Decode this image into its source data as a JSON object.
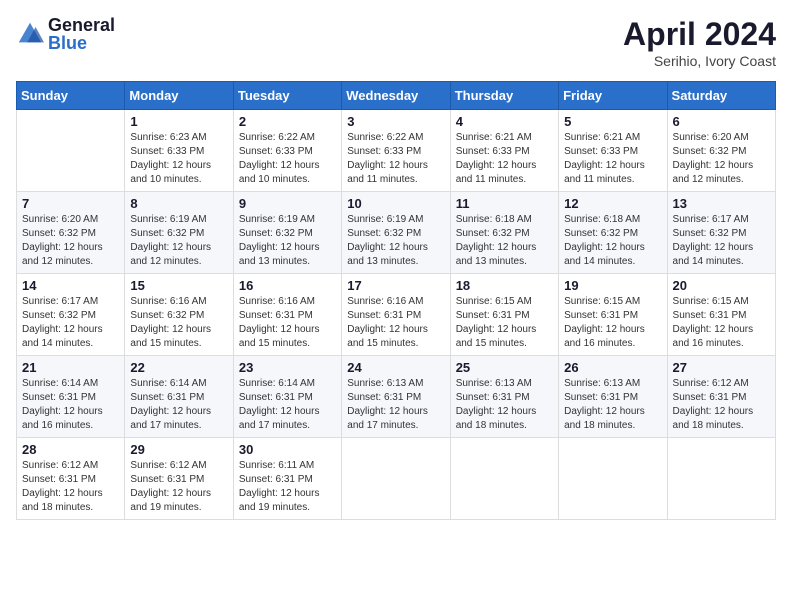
{
  "logo": {
    "general": "General",
    "blue": "Blue"
  },
  "title": {
    "month": "April 2024",
    "location": "Serihio, Ivory Coast"
  },
  "weekdays": [
    "Sunday",
    "Monday",
    "Tuesday",
    "Wednesday",
    "Thursday",
    "Friday",
    "Saturday"
  ],
  "weeks": [
    [
      {
        "day": null
      },
      {
        "day": 1,
        "sunrise": "6:23 AM",
        "sunset": "6:33 PM",
        "daylight": "12 hours and 10 minutes."
      },
      {
        "day": 2,
        "sunrise": "6:22 AM",
        "sunset": "6:33 PM",
        "daylight": "12 hours and 10 minutes."
      },
      {
        "day": 3,
        "sunrise": "6:22 AM",
        "sunset": "6:33 PM",
        "daylight": "12 hours and 11 minutes."
      },
      {
        "day": 4,
        "sunrise": "6:21 AM",
        "sunset": "6:33 PM",
        "daylight": "12 hours and 11 minutes."
      },
      {
        "day": 5,
        "sunrise": "6:21 AM",
        "sunset": "6:33 PM",
        "daylight": "12 hours and 11 minutes."
      },
      {
        "day": 6,
        "sunrise": "6:20 AM",
        "sunset": "6:32 PM",
        "daylight": "12 hours and 12 minutes."
      }
    ],
    [
      {
        "day": 7,
        "sunrise": "6:20 AM",
        "sunset": "6:32 PM",
        "daylight": "12 hours and 12 minutes."
      },
      {
        "day": 8,
        "sunrise": "6:19 AM",
        "sunset": "6:32 PM",
        "daylight": "12 hours and 12 minutes."
      },
      {
        "day": 9,
        "sunrise": "6:19 AM",
        "sunset": "6:32 PM",
        "daylight": "12 hours and 13 minutes."
      },
      {
        "day": 10,
        "sunrise": "6:19 AM",
        "sunset": "6:32 PM",
        "daylight": "12 hours and 13 minutes."
      },
      {
        "day": 11,
        "sunrise": "6:18 AM",
        "sunset": "6:32 PM",
        "daylight": "12 hours and 13 minutes."
      },
      {
        "day": 12,
        "sunrise": "6:18 AM",
        "sunset": "6:32 PM",
        "daylight": "12 hours and 14 minutes."
      },
      {
        "day": 13,
        "sunrise": "6:17 AM",
        "sunset": "6:32 PM",
        "daylight": "12 hours and 14 minutes."
      }
    ],
    [
      {
        "day": 14,
        "sunrise": "6:17 AM",
        "sunset": "6:32 PM",
        "daylight": "12 hours and 14 minutes."
      },
      {
        "day": 15,
        "sunrise": "6:16 AM",
        "sunset": "6:32 PM",
        "daylight": "12 hours and 15 minutes."
      },
      {
        "day": 16,
        "sunrise": "6:16 AM",
        "sunset": "6:31 PM",
        "daylight": "12 hours and 15 minutes."
      },
      {
        "day": 17,
        "sunrise": "6:16 AM",
        "sunset": "6:31 PM",
        "daylight": "12 hours and 15 minutes."
      },
      {
        "day": 18,
        "sunrise": "6:15 AM",
        "sunset": "6:31 PM",
        "daylight": "12 hours and 15 minutes."
      },
      {
        "day": 19,
        "sunrise": "6:15 AM",
        "sunset": "6:31 PM",
        "daylight": "12 hours and 16 minutes."
      },
      {
        "day": 20,
        "sunrise": "6:15 AM",
        "sunset": "6:31 PM",
        "daylight": "12 hours and 16 minutes."
      }
    ],
    [
      {
        "day": 21,
        "sunrise": "6:14 AM",
        "sunset": "6:31 PM",
        "daylight": "12 hours and 16 minutes."
      },
      {
        "day": 22,
        "sunrise": "6:14 AM",
        "sunset": "6:31 PM",
        "daylight": "12 hours and 17 minutes."
      },
      {
        "day": 23,
        "sunrise": "6:14 AM",
        "sunset": "6:31 PM",
        "daylight": "12 hours and 17 minutes."
      },
      {
        "day": 24,
        "sunrise": "6:13 AM",
        "sunset": "6:31 PM",
        "daylight": "12 hours and 17 minutes."
      },
      {
        "day": 25,
        "sunrise": "6:13 AM",
        "sunset": "6:31 PM",
        "daylight": "12 hours and 18 minutes."
      },
      {
        "day": 26,
        "sunrise": "6:13 AM",
        "sunset": "6:31 PM",
        "daylight": "12 hours and 18 minutes."
      },
      {
        "day": 27,
        "sunrise": "6:12 AM",
        "sunset": "6:31 PM",
        "daylight": "12 hours and 18 minutes."
      }
    ],
    [
      {
        "day": 28,
        "sunrise": "6:12 AM",
        "sunset": "6:31 PM",
        "daylight": "12 hours and 18 minutes."
      },
      {
        "day": 29,
        "sunrise": "6:12 AM",
        "sunset": "6:31 PM",
        "daylight": "12 hours and 19 minutes."
      },
      {
        "day": 30,
        "sunrise": "6:11 AM",
        "sunset": "6:31 PM",
        "daylight": "12 hours and 19 minutes."
      },
      {
        "day": null
      },
      {
        "day": null
      },
      {
        "day": null
      },
      {
        "day": null
      }
    ]
  ]
}
